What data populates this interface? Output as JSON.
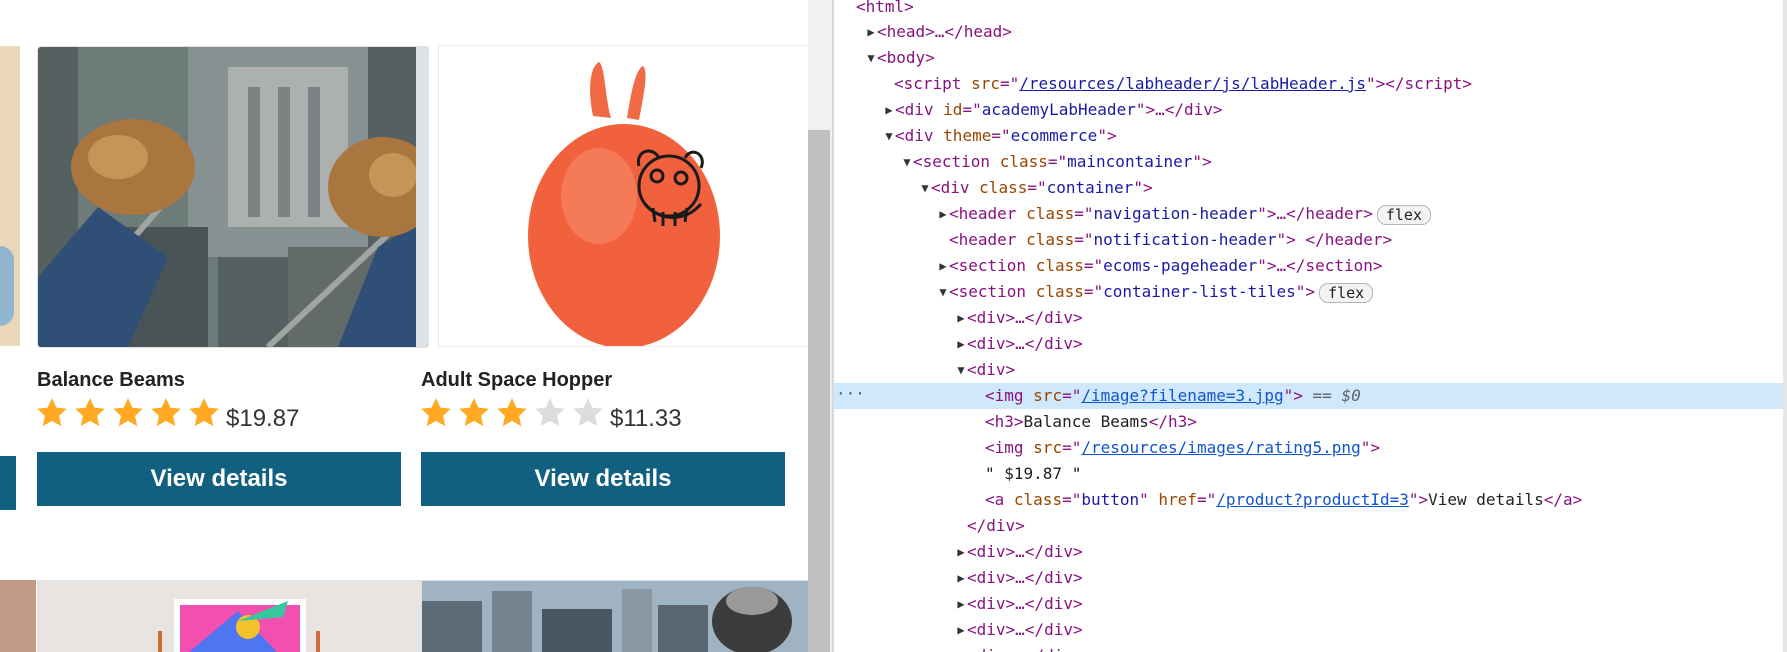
{
  "shop": {
    "products": [
      {
        "name": "Balance Beams",
        "price": "$19.87",
        "rating": 5,
        "button": "View details"
      },
      {
        "name": "Adult Space Hopper",
        "price": "$11.33",
        "rating": 3,
        "button": "View details"
      }
    ],
    "max_rating": 5,
    "colors": {
      "button": "#11607f",
      "star_on": "#ffaa22",
      "star_off": "#dcdcdc"
    }
  },
  "devtools": {
    "lines": {
      "html": "<html>",
      "head": "<head>…</head>",
      "body": "<body>",
      "script_src": "/resources/labheader/js/labHeader.js",
      "academy_id": "academyLabHeader",
      "theme": "ecommerce",
      "maincontainer": "maincontainer",
      "container": "container",
      "nav_header": "navigation-header",
      "notif_header": "notification-header",
      "ecoms_pageheader": "ecoms-pageheader",
      "list_tiles": "container-list-tiles",
      "div_collapsed": "<div>…</div>",
      "div_open": "<div>",
      "img_src": "/image?filename=3.jpg",
      "selected_marker": "== $0",
      "h3_text": "Balance Beams",
      "rating_src": "/resources/images/rating5.png",
      "price_text": "\" $19.87 \"",
      "a_class": "button",
      "a_href": "/product?productId=3",
      "a_text": "View details",
      "div_close": "</div>",
      "flex_badge": "flex",
      "more": "···"
    }
  }
}
